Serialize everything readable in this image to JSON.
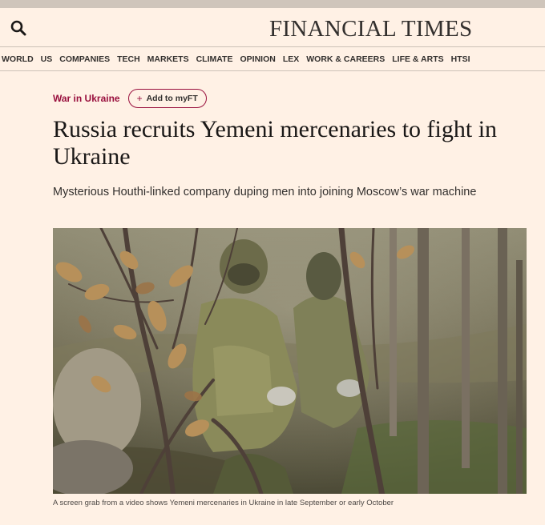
{
  "masthead": {
    "logo": "FINANCIAL TIMES",
    "search_icon": "search-icon"
  },
  "nav": {
    "items": [
      "WORLD",
      "US",
      "COMPANIES",
      "TECH",
      "MARKETS",
      "CLIMATE",
      "OPINION",
      "LEX",
      "WORK & CAREERS",
      "LIFE & ARTS",
      "HTSI"
    ]
  },
  "article": {
    "topic": "War in Ukraine",
    "myft_label": "Add to myFT",
    "myft_icon": "plus-icon",
    "headline": "Russia recruits Yemeni mercenaries to fight in Ukraine",
    "standfirst": "Mysterious Houthi-linked company duping men into joining Moscow’s war machine",
    "caption": "A screen grab from a video shows Yemeni mercenaries in Ukraine in late September or early October"
  },
  "colors": {
    "background": "#fff1e5",
    "accent": "#990f3d",
    "text": "#33302e"
  }
}
